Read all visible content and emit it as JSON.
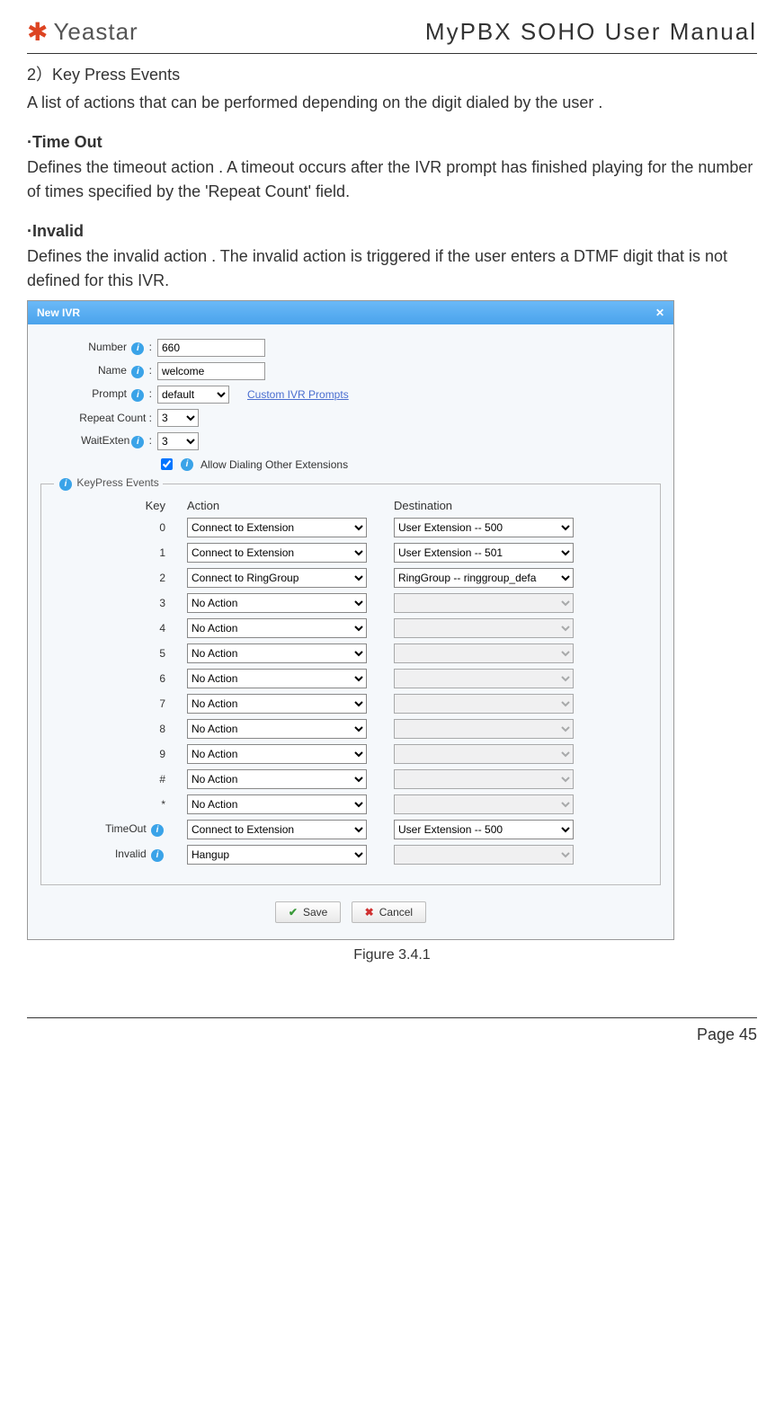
{
  "header": {
    "logo_text": "Yeastar",
    "doc_title": "MyPBX SOHO User Manual"
  },
  "intro": {
    "heading": "2）Key Press Events",
    "desc": "A list of actions that can be performed depending on the digit dialed by the user ."
  },
  "timeout": {
    "heading": "·Time Out",
    "desc": "Defines the timeout action . A timeout occurs after the IVR prompt has finished playing for the number of times specified by the 'Repeat Count' field."
  },
  "invalid": {
    "heading": "·Invalid",
    "desc": "Defines the invalid action . The invalid action is triggered if the user enters a DTMF digit that is not defined for this IVR."
  },
  "dialog": {
    "title": "New IVR",
    "close": "✕",
    "number_label": "Number",
    "number_value": "660",
    "name_label": "Name",
    "name_value": "welcome",
    "prompt_label": "Prompt",
    "prompt_value": "default",
    "custom_link": "Custom IVR Prompts",
    "repeat_label": "Repeat Count :",
    "repeat_value": "3",
    "waitexten_label": "WaitExten",
    "waitexten_value": "3",
    "allow_dial_label": "Allow Dialing Other Extensions",
    "kp_legend": "KeyPress Events",
    "kp_key_header": "Key",
    "kp_action_header": "Action",
    "kp_dest_header": "Destination",
    "rows": [
      {
        "key": "0",
        "action": "Connect to Extension",
        "dest": "User Extension -- 500",
        "dest_enabled": true
      },
      {
        "key": "1",
        "action": "Connect to Extension",
        "dest": "User Extension -- 501",
        "dest_enabled": true
      },
      {
        "key": "2",
        "action": "Connect to RingGroup",
        "dest": "RingGroup -- ringgroup_defa",
        "dest_enabled": true
      },
      {
        "key": "3",
        "action": "No Action",
        "dest": "",
        "dest_enabled": false
      },
      {
        "key": "4",
        "action": "No Action",
        "dest": "",
        "dest_enabled": false
      },
      {
        "key": "5",
        "action": "No Action",
        "dest": "",
        "dest_enabled": false
      },
      {
        "key": "6",
        "action": "No Action",
        "dest": "",
        "dest_enabled": false
      },
      {
        "key": "7",
        "action": "No Action",
        "dest": "",
        "dest_enabled": false
      },
      {
        "key": "8",
        "action": "No Action",
        "dest": "",
        "dest_enabled": false
      },
      {
        "key": "9",
        "action": "No Action",
        "dest": "",
        "dest_enabled": false
      },
      {
        "key": "#",
        "action": "No Action",
        "dest": "",
        "dest_enabled": false
      },
      {
        "key": "*",
        "action": "No Action",
        "dest": "",
        "dest_enabled": false
      },
      {
        "key": "TimeOut",
        "action": "Connect to Extension",
        "dest": "User Extension -- 500",
        "dest_enabled": true,
        "info": true
      },
      {
        "key": "Invalid",
        "action": "Hangup",
        "dest": "",
        "dest_enabled": false,
        "info": true
      }
    ],
    "save_label": "Save",
    "cancel_label": "Cancel"
  },
  "caption": "Figure 3.4.1",
  "footer": "Page 45"
}
